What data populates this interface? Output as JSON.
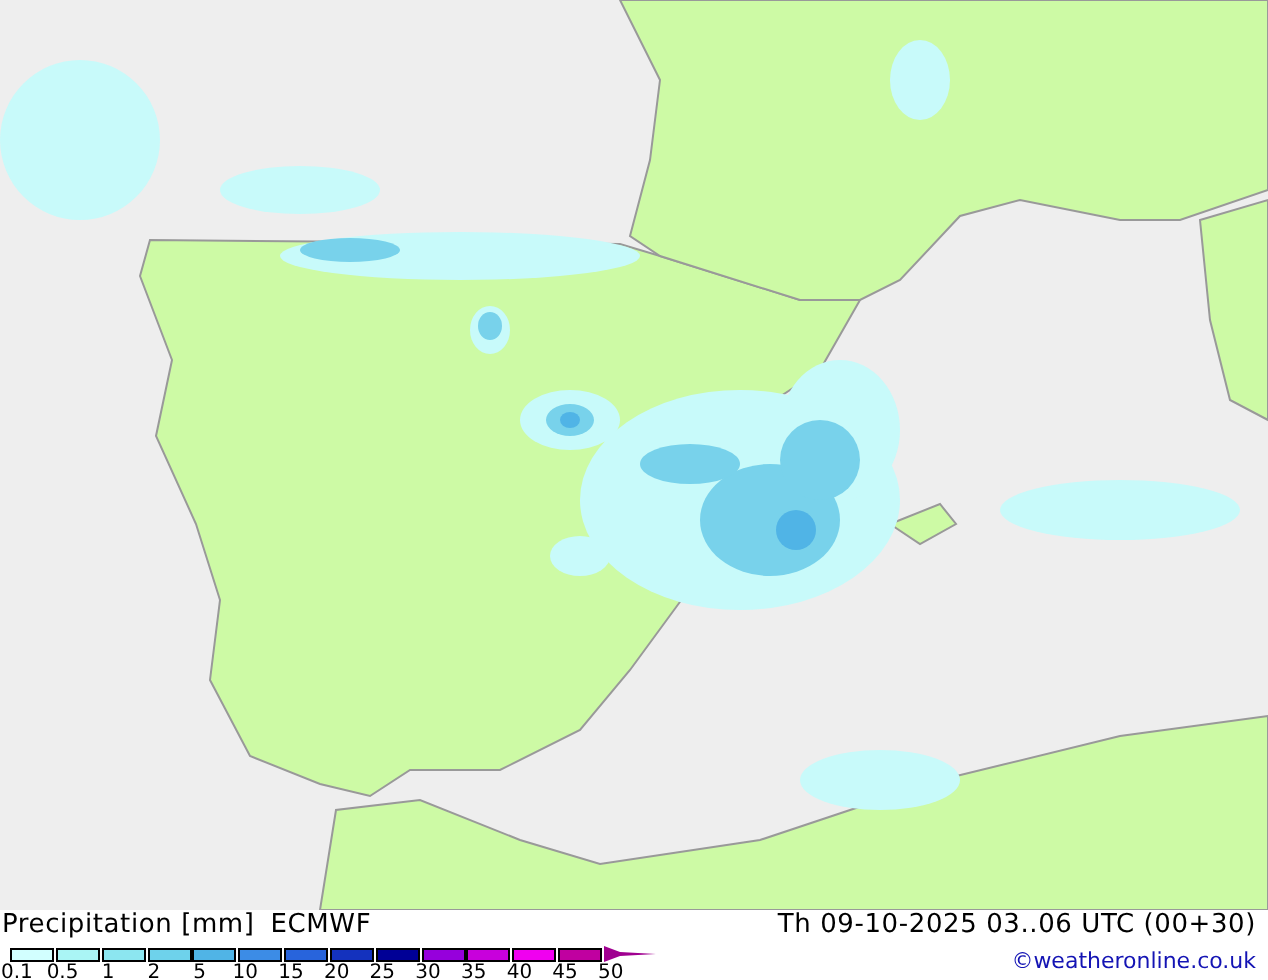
{
  "legend": {
    "title": "Precipitation [mm]",
    "model": "ECMWF",
    "bins": [
      {
        "color": "#d2ffff"
      },
      {
        "color": "#aaf5f5"
      },
      {
        "color": "#8ce6f0"
      },
      {
        "color": "#6ed2eb"
      },
      {
        "color": "#50b4e6"
      },
      {
        "color": "#3c8ce6"
      },
      {
        "color": "#2864dc"
      },
      {
        "color": "#1432be"
      },
      {
        "color": "#000096"
      },
      {
        "color": "#9600dc"
      },
      {
        "color": "#c800dc"
      },
      {
        "color": "#f000f0"
      },
      {
        "color": "#c000a0"
      }
    ],
    "ticks": [
      "0.1",
      "0.5",
      "1",
      "2",
      "5",
      "10",
      "15",
      "20",
      "25",
      "30",
      "35",
      "40",
      "45",
      "50"
    ]
  },
  "valid_time": "Th 09-10-2025 03..06 UTC (00+30)",
  "credit": "©weatheronline.co.uk"
}
